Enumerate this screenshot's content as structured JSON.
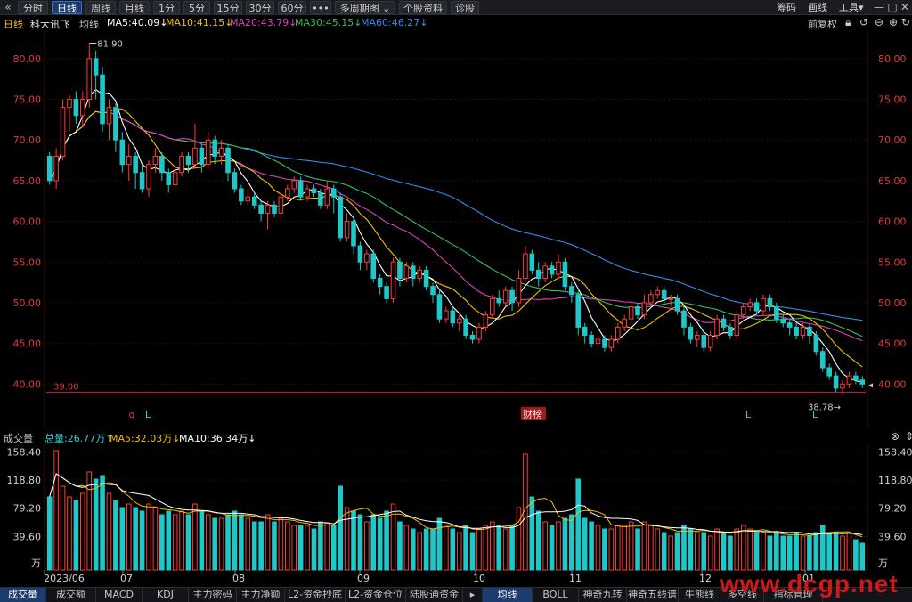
{
  "toolbar": {
    "back_icon": "double-chevron-left",
    "periods": [
      "分时",
      "日线",
      "周线",
      "月线",
      "1分",
      "5分",
      "15分",
      "30分",
      "60分",
      "•••",
      "多周期图 ⌄",
      "个股资料",
      "诊股"
    ],
    "active_period": "日线",
    "right_items": [
      "筹码",
      "画线",
      "工具▾"
    ],
    "window_controls": [
      "—",
      "▢",
      "✕"
    ]
  },
  "ma_row": {
    "period": "日线",
    "stock_name": "科大讯飞",
    "mode": "均线",
    "ma5": "MA5:40.09↓",
    "ma10": "MA10:41.15↓",
    "ma20": "MA20:43.79↓",
    "ma30": "MA30:45.15↓",
    "ma60": "MA60:46.27↓",
    "adjust": "前复权",
    "colors": {
      "ma5": "#ffffff",
      "ma10": "#f0c000",
      "ma20": "#e040c0",
      "ma30": "#30c060",
      "ma60": "#2f8fe8"
    }
  },
  "price_axis": {
    "ticks": [
      "80.00",
      "75.00",
      "70.00",
      "65.00",
      "60.00",
      "55.00",
      "50.00",
      "45.00",
      "40.00"
    ],
    "marker_left": "39.00",
    "high_label": "81.90",
    "low_label": "38.78→",
    "current_marker": "◂",
    "events": [
      "q",
      "L",
      "财榜",
      "L",
      "L"
    ]
  },
  "volume": {
    "label": "成交量",
    "total": "总量:26.77万↑",
    "ma5": "MA5:32.03万↓",
    "ma10": "MA10:36.34万↓",
    "ticks": [
      "158.40",
      "118.80",
      "79.20",
      "39.60",
      "万"
    ],
    "close_icon": "close-circle-icon",
    "expand_icon": "expand-icon"
  },
  "date_axis": [
    "2023/06",
    "07",
    "08",
    "09",
    "10",
    "11",
    "12",
    "01"
  ],
  "tabs": [
    "成交量",
    "成交额",
    "MACD",
    "KDJ",
    "主力密码",
    "主力净额",
    "L2-资金抄底",
    "L2-资金仓位",
    "陆股通资金",
    "▸",
    "均线",
    "BOLL",
    "神奇九转",
    "神奇五线谱",
    "牛熊线",
    "多空线",
    "指标管理"
  ],
  "active_tab_left": "成交量",
  "active_tab_right": "均线",
  "watermark": "www.dcgp.net",
  "chart_data": {
    "type": "candlestick",
    "price_range": [
      38.5,
      82.5
    ],
    "volume_range": [
      0,
      165
    ],
    "candles": [
      [
        68,
        65,
        68.5,
        64.5,
        95
      ],
      [
        65,
        68,
        69,
        64,
        160
      ],
      [
        68,
        74,
        75,
        67.5,
        110
      ],
      [
        74,
        75,
        75.5,
        71,
        95
      ],
      [
        75,
        73,
        76,
        72,
        90
      ],
      [
        73,
        75,
        76,
        71.5,
        100
      ],
      [
        75,
        80,
        81.9,
        74,
        130
      ],
      [
        80,
        78,
        81,
        75,
        120
      ],
      [
        78,
        72,
        79,
        71,
        125
      ],
      [
        72,
        74,
        75,
        70,
        100
      ],
      [
        74,
        70,
        74.5,
        68.5,
        90
      ],
      [
        70,
        67,
        71,
        66,
        80
      ],
      [
        67,
        68,
        69.5,
        65,
        85
      ],
      [
        68,
        66,
        68.5,
        64,
        80
      ],
      [
        66,
        64,
        67,
        63.5,
        75
      ],
      [
        64,
        67,
        67.5,
        63,
        85
      ],
      [
        67,
        68,
        69,
        66,
        80
      ],
      [
        68,
        66,
        68.5,
        65,
        70
      ],
      [
        66,
        64.5,
        66.5,
        63.5,
        75
      ],
      [
        64.5,
        66,
        67,
        64,
        70
      ],
      [
        66,
        68,
        68.5,
        65.5,
        75
      ],
      [
        68,
        67,
        68.5,
        66,
        70
      ],
      [
        67,
        69,
        72,
        66.5,
        85
      ],
      [
        69,
        67,
        69.5,
        66,
        75
      ],
      [
        67,
        70,
        71,
        66.5,
        70
      ],
      [
        70,
        68,
        70.5,
        67,
        65
      ],
      [
        68,
        69,
        70,
        67,
        65
      ],
      [
        69,
        66,
        69.5,
        65,
        70
      ],
      [
        66,
        64,
        66.5,
        63.5,
        75
      ],
      [
        64,
        62.5,
        64.5,
        62,
        70
      ],
      [
        62.5,
        63,
        64,
        62,
        65
      ],
      [
        63,
        62,
        63.5,
        61.5,
        60
      ],
      [
        62,
        61,
        62.5,
        60,
        60
      ],
      [
        61,
        62,
        62.5,
        59,
        70
      ],
      [
        62,
        61,
        62.5,
        60.5,
        60
      ],
      [
        61,
        63,
        63.5,
        60.5,
        65
      ],
      [
        63,
        64,
        64.5,
        62.5,
        60
      ],
      [
        64,
        65,
        65.5,
        63.5,
        55
      ],
      [
        65,
        63,
        65.5,
        62.5,
        55
      ],
      [
        63,
        64,
        64.5,
        62.5,
        55
      ],
      [
        64,
        63.5,
        64.5,
        63,
        50
      ],
      [
        63.5,
        62,
        64,
        61.5,
        60
      ],
      [
        62,
        64,
        65,
        61.5,
        58
      ],
      [
        64,
        63,
        64.5,
        61,
        55
      ],
      [
        63,
        58,
        63.5,
        57.5,
        110
      ],
      [
        58,
        60,
        61,
        57.5,
        80
      ],
      [
        60,
        57,
        60.5,
        56,
        75
      ],
      [
        57,
        55,
        57.5,
        54,
        70
      ],
      [
        55,
        56,
        56.5,
        54,
        60
      ],
      [
        56,
        53,
        56.5,
        52.5,
        70
      ],
      [
        53,
        52,
        53.5,
        51,
        65
      ],
      [
        52,
        50.5,
        52.5,
        50,
        75
      ],
      [
        50.5,
        55,
        55.5,
        50,
        85
      ],
      [
        55,
        53,
        55.5,
        52,
        60
      ],
      [
        53,
        54.5,
        55,
        52.5,
        55
      ],
      [
        54.5,
        53,
        55,
        52,
        50
      ],
      [
        53,
        54,
        54.5,
        52.5,
        45
      ],
      [
        54,
        52,
        54.5,
        51.5,
        50
      ],
      [
        52,
        51,
        52.5,
        50,
        50
      ],
      [
        51,
        48,
        51.5,
        47.5,
        65
      ],
      [
        48,
        49,
        49.5,
        47.5,
        55
      ],
      [
        49,
        47.5,
        49.5,
        47,
        50
      ],
      [
        47.5,
        48,
        48.5,
        46.5,
        45
      ],
      [
        48,
        46,
        48.5,
        45.5,
        55
      ],
      [
        46,
        45.5,
        46.5,
        45,
        45
      ],
      [
        45.5,
        47,
        47.5,
        45,
        50
      ],
      [
        47,
        48.5,
        49,
        46.5,
        55
      ],
      [
        48.5,
        50.5,
        51,
        48,
        60
      ],
      [
        50.5,
        50,
        51.5,
        49.5,
        55
      ],
      [
        50,
        51.5,
        52,
        49.5,
        50
      ],
      [
        51.5,
        50,
        52,
        49,
        55
      ],
      [
        50,
        53,
        54,
        49.5,
        80
      ],
      [
        53,
        56,
        57,
        52.5,
        155
      ],
      [
        56,
        54,
        56.5,
        53.5,
        95
      ],
      [
        54,
        53,
        55,
        52,
        75
      ],
      [
        53,
        54.5,
        55,
        52.5,
        60
      ],
      [
        54.5,
        53.5,
        55,
        53,
        55
      ],
      [
        53.5,
        55,
        56,
        53,
        60
      ],
      [
        55,
        52,
        55.5,
        51.5,
        65
      ],
      [
        52,
        51,
        52.5,
        50,
        70
      ],
      [
        51,
        47,
        51.5,
        46,
        120
      ],
      [
        47,
        46,
        47.5,
        45,
        65
      ],
      [
        46,
        45,
        46.5,
        44.5,
        60
      ],
      [
        45,
        45.5,
        46,
        44.5,
        55
      ],
      [
        45.5,
        44.5,
        46,
        44,
        50
      ],
      [
        44.5,
        45.5,
        46,
        44,
        50
      ],
      [
        45.5,
        47,
        47.5,
        45,
        55
      ],
      [
        47,
        48,
        48.5,
        46.5,
        55
      ],
      [
        48,
        49.5,
        50,
        47.5,
        60
      ],
      [
        49.5,
        48.5,
        50,
        48,
        50
      ],
      [
        48.5,
        50,
        51,
        48,
        60
      ],
      [
        50,
        51,
        51.5,
        49.5,
        55
      ],
      [
        51,
        51.5,
        52,
        50.5,
        50
      ],
      [
        51.5,
        50.5,
        52,
        50,
        45
      ],
      [
        50.5,
        50.5,
        51,
        49.5,
        40
      ],
      [
        50.5,
        49,
        51,
        48.5,
        45
      ],
      [
        49,
        47,
        49.5,
        46,
        55
      ],
      [
        47,
        45.5,
        47.5,
        45,
        50
      ],
      [
        45.5,
        46,
        46.5,
        44.5,
        45
      ],
      [
        46,
        44.5,
        46.5,
        44,
        45
      ],
      [
        44.5,
        46,
        46.5,
        44,
        40
      ],
      [
        46,
        48,
        48.5,
        45.5,
        50
      ],
      [
        48,
        47,
        48.5,
        46.5,
        45
      ],
      [
        47,
        46,
        47.5,
        45.5,
        40
      ],
      [
        46,
        48.5,
        49,
        45.5,
        50
      ],
      [
        48.5,
        49.5,
        50,
        48,
        55
      ],
      [
        49.5,
        50,
        50.5,
        49,
        50
      ],
      [
        50,
        49,
        50.5,
        48.5,
        45
      ],
      [
        49,
        50.5,
        51,
        48.5,
        45
      ],
      [
        50.5,
        49.5,
        51,
        49,
        40
      ],
      [
        49.5,
        48,
        50,
        47.5,
        45
      ],
      [
        48,
        47.5,
        48.5,
        47,
        40
      ],
      [
        47.5,
        47,
        48,
        46,
        40
      ],
      [
        47,
        46,
        47.5,
        45.5,
        45
      ],
      [
        46,
        47,
        47.5,
        45.5,
        40
      ],
      [
        47,
        46,
        47.5,
        45,
        40
      ],
      [
        46,
        44,
        46.5,
        43.5,
        45
      ],
      [
        44,
        42,
        44.5,
        41.5,
        55
      ],
      [
        42,
        41,
        42.5,
        40.5,
        45
      ],
      [
        41,
        39.5,
        41.5,
        39,
        45
      ],
      [
        39.5,
        40,
        40.5,
        38.78,
        40
      ],
      [
        40,
        41,
        41.5,
        39.5,
        45
      ],
      [
        41,
        40.5,
        41.5,
        40,
        35
      ],
      [
        40.5,
        40,
        41,
        39.5,
        30
      ]
    ]
  }
}
